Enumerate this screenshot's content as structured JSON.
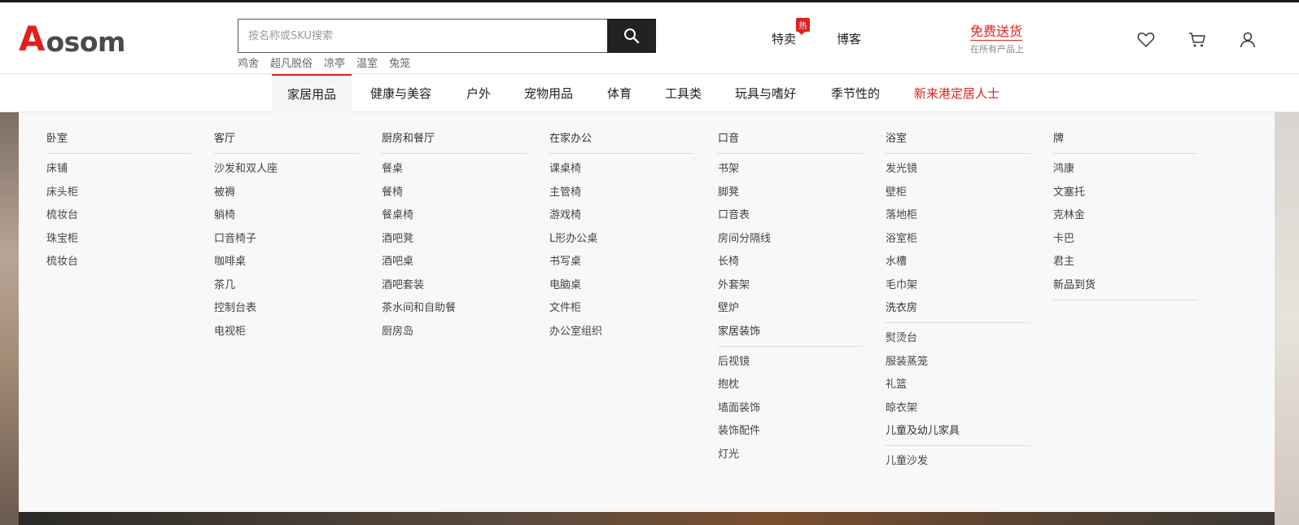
{
  "header": {
    "logo": "Aosom",
    "search": {
      "placeholder": "按名称或SKU搜索",
      "value": ""
    },
    "hot_keywords": [
      "鸡舍",
      "超凡脱俗",
      "凉亭",
      "温室",
      "兔笼"
    ],
    "links": {
      "specials": "特卖",
      "hot_badge": "热",
      "blog": "博客"
    },
    "free_shipping": {
      "title": "免费送货",
      "subtitle": "在所有产品上"
    },
    "icons": [
      "heart-icon",
      "cart-icon",
      "user-icon",
      "search-icon"
    ]
  },
  "nav": {
    "items": [
      "家居用品",
      "健康与美容",
      "户外",
      "宠物用品",
      "体育",
      "工具类",
      "玩具与嗜好",
      "季节性的",
      "新来港定居人士"
    ],
    "active": "家居用品",
    "accent_color": "#e02020"
  },
  "mega_menu": {
    "columns": [
      {
        "sections": [
          {
            "title": "卧室",
            "links": [
              "床铺",
              "床头柜",
              "梳妆台",
              "珠宝柜",
              "梳妆台"
            ]
          }
        ]
      },
      {
        "sections": [
          {
            "title": "客厅",
            "links": [
              "沙发和双人座",
              "被褥",
              "躺椅",
              "口音椅子",
              "咖啡桌",
              "茶几",
              "控制台表",
              "电视柜"
            ]
          }
        ]
      },
      {
        "sections": [
          {
            "title": "厨房和餐厅",
            "links": [
              "餐桌",
              "餐椅",
              "餐桌椅",
              "酒吧凳",
              "酒吧桌",
              "酒吧套装",
              "茶水间和自助餐",
              "厨房岛"
            ]
          }
        ]
      },
      {
        "sections": [
          {
            "title": "在家办公",
            "links": [
              "课桌椅",
              "主管椅",
              "游戏椅",
              "L形办公桌",
              "书写桌",
              "电脑桌",
              "文件柜",
              "办公室组织"
            ]
          }
        ]
      },
      {
        "sections": [
          {
            "title": "口音",
            "links": [
              "书架",
              "脚凳",
              "口音表",
              "房间分隔线",
              "长椅",
              "外套架",
              "壁炉"
            ]
          },
          {
            "title": "家居装饰",
            "links": [
              "后视镜",
              "抱枕",
              "墙面装饰",
              "装饰配件",
              "灯光"
            ]
          }
        ]
      },
      {
        "sections": [
          {
            "title": "浴室",
            "links": [
              "发光镜",
              "壁柜",
              "落地柜",
              "浴室柜",
              "水槽",
              "毛巾架"
            ]
          },
          {
            "title": "洗衣房",
            "links": [
              "熨烫台",
              "服装蒸笼",
              "礼篮",
              "晾衣架"
            ]
          },
          {
            "title": "儿童及幼儿家具",
            "links": [
              "儿童沙发"
            ]
          }
        ]
      },
      {
        "sections": [
          {
            "title": "牌",
            "links": [
              "鸿康",
              "文塞托",
              "克林金",
              "卡巴",
              "君主"
            ]
          },
          {
            "title": "新品到货",
            "links": []
          }
        ]
      }
    ]
  }
}
